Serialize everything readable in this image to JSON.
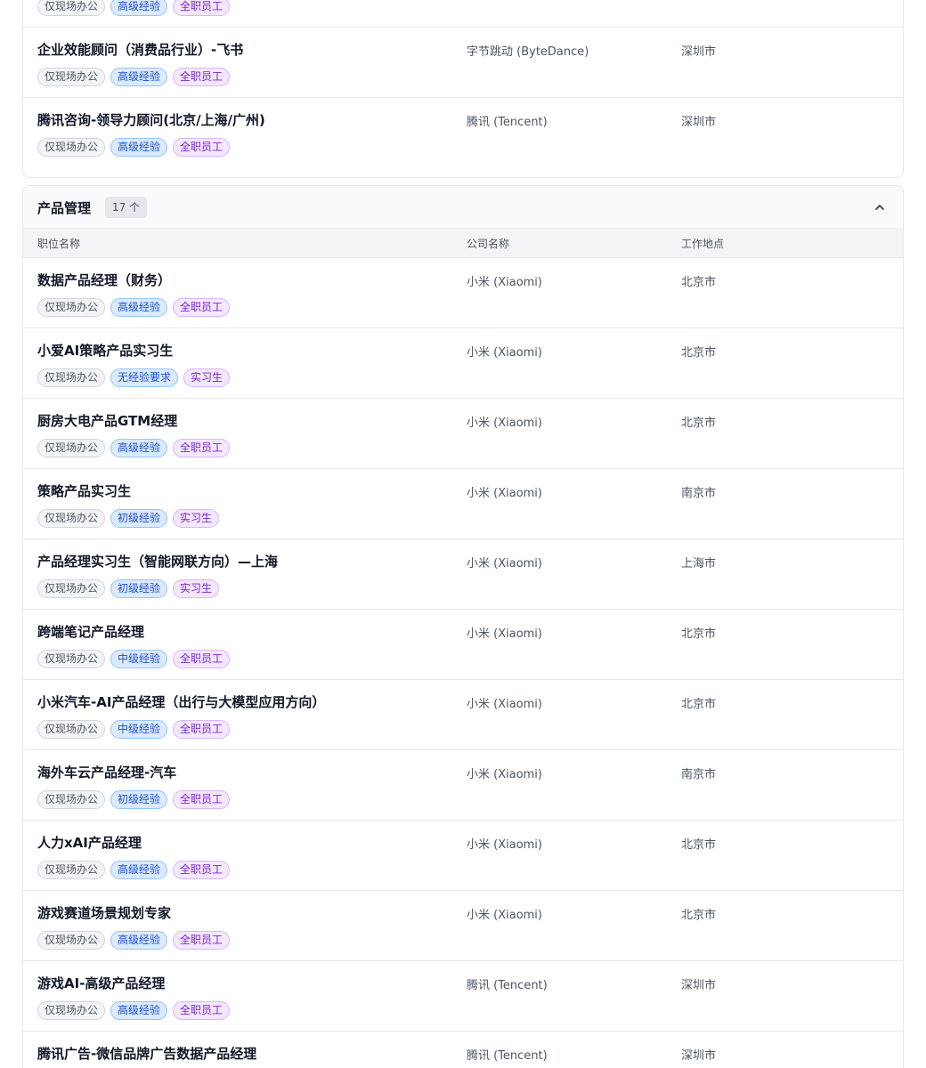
{
  "previous_section": {
    "partial_tags": [
      "仅现场办公",
      "高级经验",
      "全职员工"
    ],
    "jobs": [
      {
        "title": "企业效能顾问（消费品行业）-飞书",
        "company": "字节跳动 (ByteDance)",
        "location": "深圳市",
        "tags": [
          "仅现场办公",
          "高级经验",
          "全职员工"
        ]
      },
      {
        "title": "腾讯咨询-领导力顾问(北京/上海/广州)",
        "company": "腾讯 (Tencent)",
        "location": "深圳市",
        "tags": [
          "仅现场办公",
          "高级经验",
          "全职员工"
        ]
      }
    ]
  },
  "section": {
    "title": "产品管理",
    "count": "17 个",
    "columns": {
      "title": "职位名称",
      "company": "公司名称",
      "location": "工作地点"
    },
    "jobs": [
      {
        "title": "数据产品经理（财务）",
        "company": "小米 (Xiaomi)",
        "location": "北京市",
        "tags": [
          "仅现场办公",
          "高级经验",
          "全职员工"
        ]
      },
      {
        "title": "小爱AI策略产品实习生",
        "company": "小米 (Xiaomi)",
        "location": "北京市",
        "tags": [
          "仅现场办公",
          "无经验要求",
          "实习生"
        ]
      },
      {
        "title": "厨房大电产品GTM经理",
        "company": "小米 (Xiaomi)",
        "location": "北京市",
        "tags": [
          "仅现场办公",
          "高级经验",
          "全职员工"
        ]
      },
      {
        "title": "策略产品实习生",
        "company": "小米 (Xiaomi)",
        "location": "南京市",
        "tags": [
          "仅现场办公",
          "初级经验",
          "实习生"
        ]
      },
      {
        "title": "产品经理实习生（智能网联方向）—上海",
        "company": "小米 (Xiaomi)",
        "location": "上海市",
        "tags": [
          "仅现场办公",
          "初级经验",
          "实习生"
        ]
      },
      {
        "title": "跨端笔记产品经理",
        "company": "小米 (Xiaomi)",
        "location": "北京市",
        "tags": [
          "仅现场办公",
          "中级经验",
          "全职员工"
        ]
      },
      {
        "title": "小米汽车-AI产品经理（出行与大模型应用方向）",
        "company": "小米 (Xiaomi)",
        "location": "北京市",
        "tags": [
          "仅现场办公",
          "中级经验",
          "全职员工"
        ]
      },
      {
        "title": "海外车云产品经理-汽车",
        "company": "小米 (Xiaomi)",
        "location": "南京市",
        "tags": [
          "仅现场办公",
          "初级经验",
          "全职员工"
        ]
      },
      {
        "title": "人力xAI产品经理",
        "company": "小米 (Xiaomi)",
        "location": "北京市",
        "tags": [
          "仅现场办公",
          "高级经验",
          "全职员工"
        ]
      },
      {
        "title": "游戏赛道场景规划专家",
        "company": "小米 (Xiaomi)",
        "location": "北京市",
        "tags": [
          "仅现场办公",
          "高级经验",
          "全职员工"
        ]
      },
      {
        "title": "游戏AI-高级产品经理",
        "company": "腾讯 (Tencent)",
        "location": "深圳市",
        "tags": [
          "仅现场办公",
          "高级经验",
          "全职员工"
        ]
      },
      {
        "title": "腾讯广告-微信品牌广告数据产品经理",
        "company": "腾讯 (Tencent)",
        "location": "深圳市",
        "tags": []
      }
    ]
  }
}
